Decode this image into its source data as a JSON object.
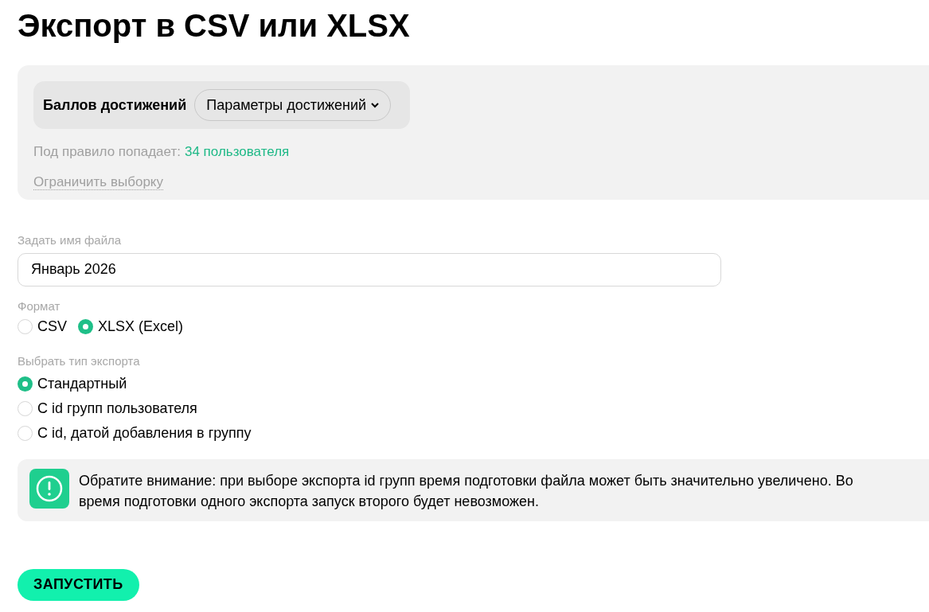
{
  "title": "Экспорт в CSV или XLSX",
  "rule": {
    "label": "Баллов достижений",
    "dropdown": "Параметры достижений",
    "match_label": "Под правило попадает:",
    "match_count": "34 пользователя",
    "limit_link": "Ограничить выборку"
  },
  "file_name": {
    "label": "Задать имя файла",
    "value": "Январь 2026"
  },
  "format": {
    "label": "Формат",
    "options": [
      {
        "label": "CSV",
        "selected": false
      },
      {
        "label": "XLSX (Excel)",
        "selected": true
      }
    ]
  },
  "export_type": {
    "label": "Выбрать тип экспорта",
    "options": [
      {
        "label": "Стандартный",
        "selected": true
      },
      {
        "label": "С id групп пользователя",
        "selected": false
      },
      {
        "label": "С id, датой добавления в группу",
        "selected": false
      }
    ]
  },
  "notice": "Обратите внимание: при выборе экспорта id групп время подготовки файла может быть значительно увеличено. Во время подготовки одного экспорта запуск второго будет невозможен.",
  "submit": "ЗАПУСТИТЬ"
}
